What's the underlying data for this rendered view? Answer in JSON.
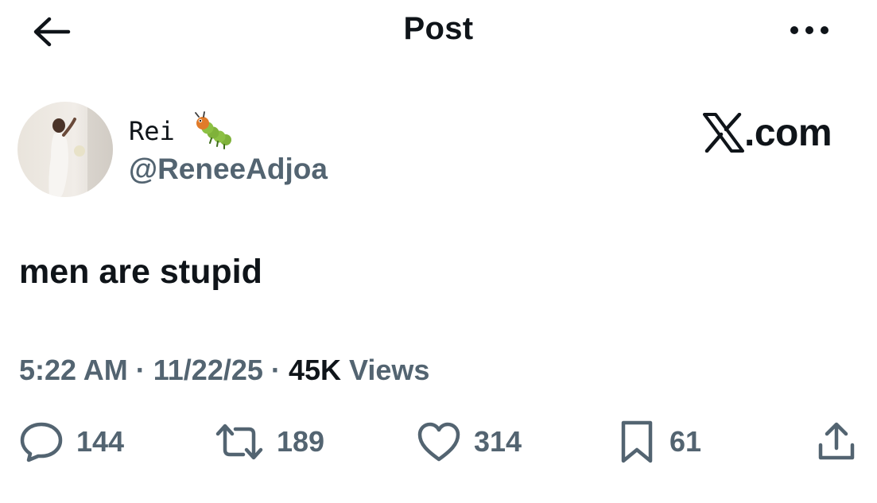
{
  "header": {
    "title": "Post",
    "back_icon": "arrow-left-icon",
    "more_icon": "more-horizontal-icon"
  },
  "author": {
    "display_name": "Rei",
    "name_emoji": "caterpillar-emoji",
    "handle": "@ReneeAdjoa"
  },
  "watermark": {
    "logo_icon": "x-logo-icon",
    "text": ".com"
  },
  "post": {
    "text": "men are stupid"
  },
  "meta": {
    "time": "5:22 AM",
    "separator": "·",
    "date": "11/22/25",
    "views_count": "45K",
    "views_label": "Views"
  },
  "actions": {
    "replies": "144",
    "reposts": "189",
    "likes": "314",
    "bookmarks": "61"
  },
  "colors": {
    "text": "#0f1419",
    "secondary": "#536471",
    "background": "#ffffff"
  }
}
